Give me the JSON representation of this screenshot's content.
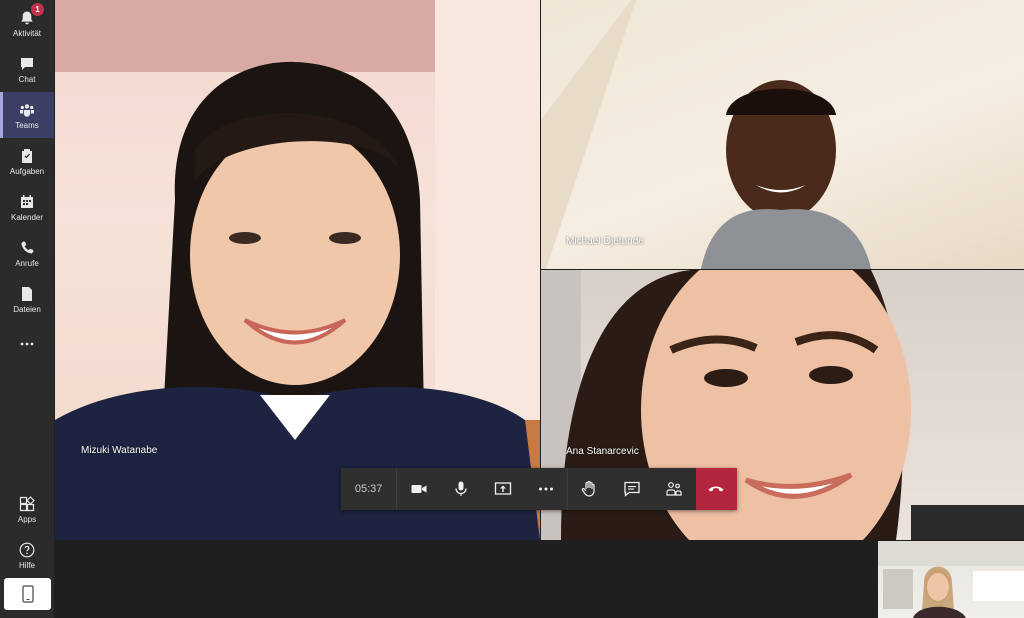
{
  "rail": {
    "items": [
      {
        "label": "Aktivität",
        "icon": "bell-icon",
        "badge": "1"
      },
      {
        "label": "Chat",
        "icon": "chat-icon"
      },
      {
        "label": "Teams",
        "icon": "teams-icon"
      },
      {
        "label": "Aufgaben",
        "icon": "tasks-icon"
      },
      {
        "label": "Kalender",
        "icon": "calendar-icon"
      },
      {
        "label": "Anrufe",
        "icon": "phone-icon"
      },
      {
        "label": "Dateien",
        "icon": "file-icon"
      },
      {
        "label": "…",
        "icon": "more-icon"
      }
    ],
    "bottom": [
      {
        "label": "Apps",
        "icon": "apps-icon"
      },
      {
        "label": "Hilfe",
        "icon": "help-icon"
      }
    ],
    "active": "Teams",
    "accent": "#a6a7dc"
  },
  "participants": [
    {
      "name": "Mizuki Watanabe"
    },
    {
      "name": "Michael Ojetunde"
    },
    {
      "name": "Ana Stanarcevic"
    }
  ],
  "controls": {
    "timer": "05:37",
    "buttons": [
      "camera-icon",
      "microphone-icon",
      "share-screen-icon",
      "more-options-icon",
      "raise-hand-icon",
      "chat-icon",
      "participants-icon",
      "hang-up-icon"
    ],
    "hangup_color": "#b4263f"
  }
}
